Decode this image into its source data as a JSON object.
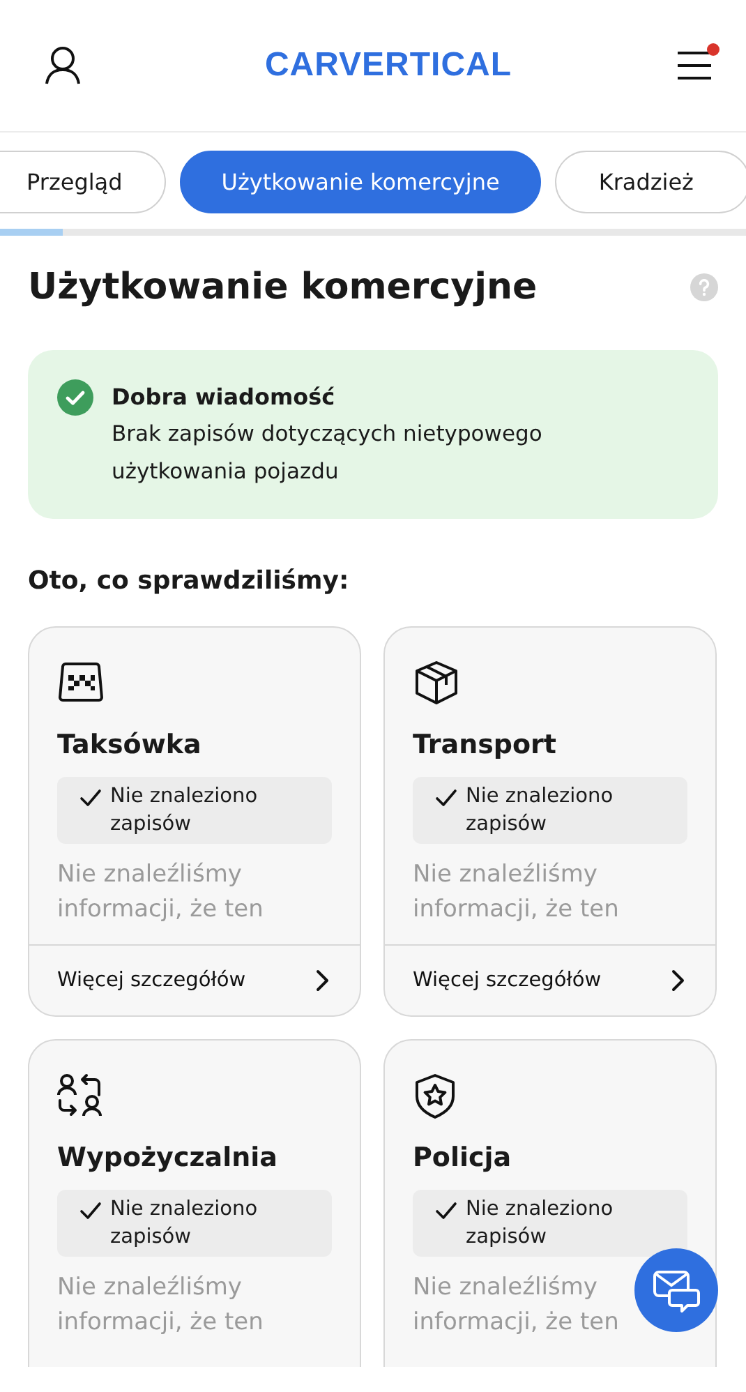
{
  "header": {
    "logo": "CARVERTICAL",
    "menu_notification": true
  },
  "tabs": [
    {
      "label": "Przegląd",
      "selected": false
    },
    {
      "label": "Użytkowanie komercyjne",
      "selected": true
    },
    {
      "label": "Kradzież",
      "selected": false
    }
  ],
  "progress": {
    "level": 0.085
  },
  "title": "Użytkowanie komercyjne",
  "alert": {
    "kind": "success",
    "title": "Dobra wiadomość",
    "text": "Brak zapisów dotyczących nietypowego użytkowania pojazdu"
  },
  "section_heading": "Oto, co sprawdziliśmy:",
  "cards": [
    {
      "kind": "taxi",
      "title": "Taksówka",
      "status": "Nie znaleziono zapisów",
      "description": "Nie znaleźliśmy informacji, że ten",
      "link": "Więcej szczegółów"
    },
    {
      "kind": "box",
      "title": "Transport",
      "status": "Nie znaleziono zapisów",
      "description": "Nie znaleźliśmy informacji, że ten",
      "link": "Więcej szczegółów"
    },
    {
      "kind": "swap",
      "title": "Wypożyczalnia",
      "status": "Nie znaleziono zapisów",
      "description": "Nie znaleźliśmy informacji, że ten"
    },
    {
      "kind": "shield",
      "title": "Policja",
      "status": "Nie znaleziono zapisów",
      "description": "Nie znaleźliśmy informacji, że ten"
    }
  ]
}
